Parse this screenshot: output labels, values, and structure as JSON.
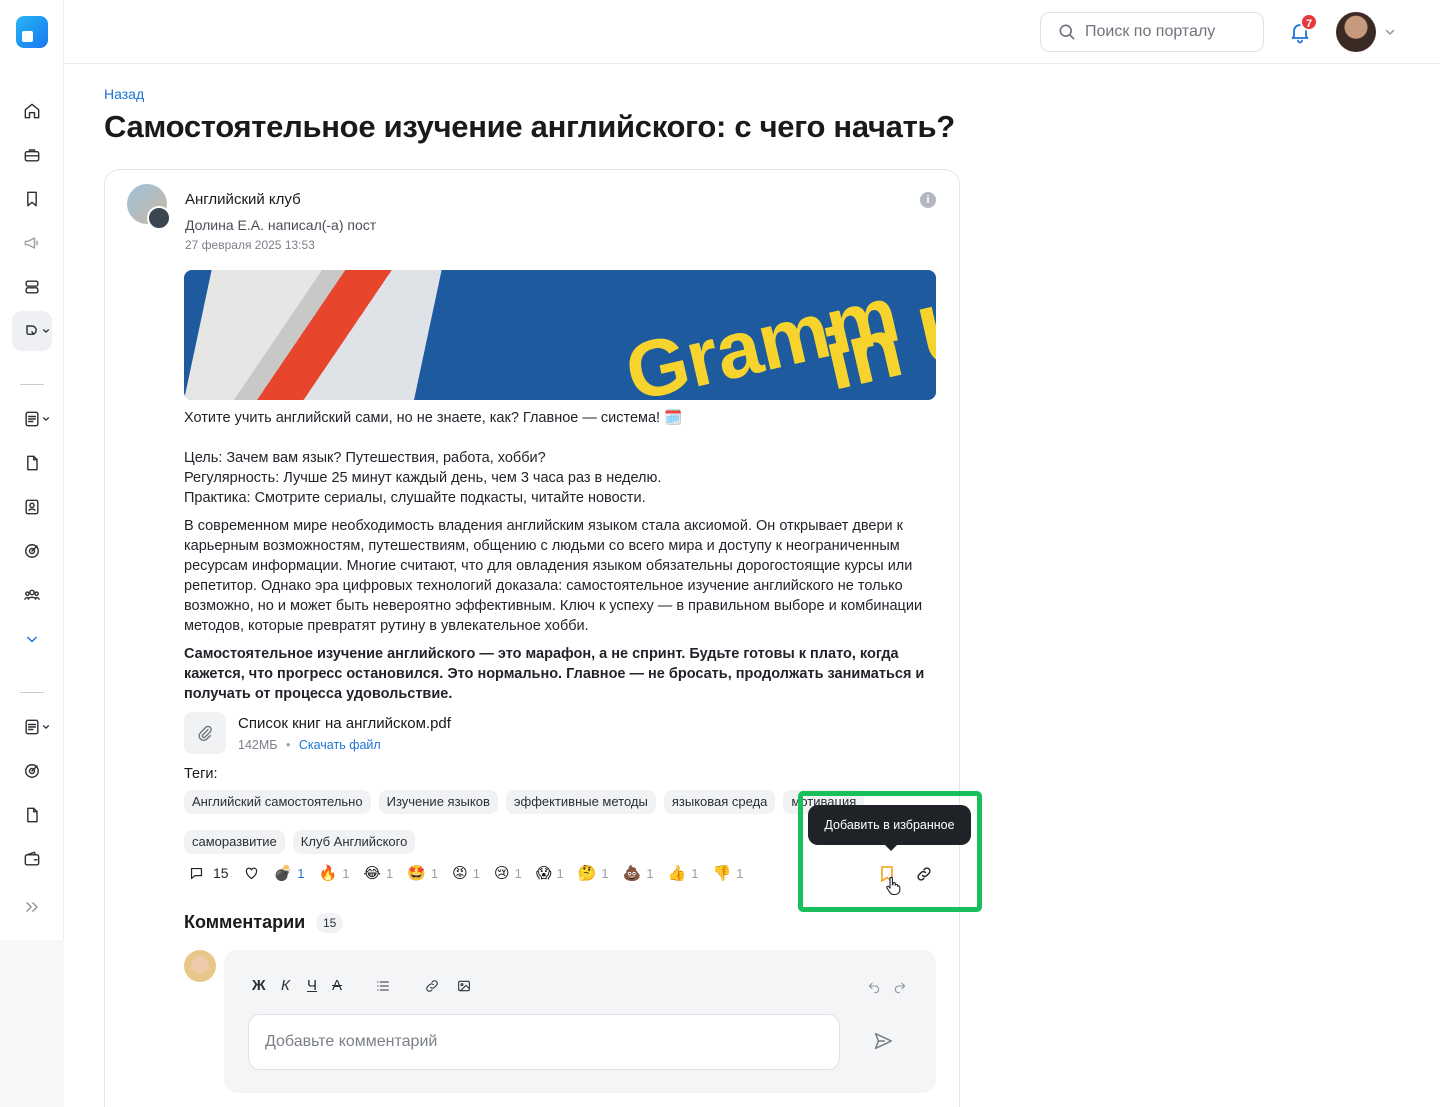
{
  "search": {
    "placeholder": "Поиск по порталу"
  },
  "notifications": {
    "count": "7"
  },
  "page": {
    "back_label": "Назад",
    "title": "Самостоятельное изучение английского: с чего начать?"
  },
  "post": {
    "club_name": "Английский клуб",
    "author_line": "Долина Е.А. написал(-а) пост",
    "date": "27 февраля 2025 13:53",
    "info_icon_label": "i",
    "cover_words": [
      "Gramm",
      "in Us"
    ],
    "intro": "Хотите учить английский сами, но не знаете, как? Главное — система! 🗓️",
    "goal": "Цель: Зачем вам язык? Путешествия, работа, хобби?",
    "regularity": "Регулярность: Лучше 25 минут каждый день, чем 3 часа раз в неделю.",
    "practice": "Практика: Смотрите сериалы, слушайте подкасты, читайте новости.",
    "paragraph": "В современном мире необходимость владения английским языком стала аксиомой. Он открывает двери к карьерным возможностям, путешествиям, общению с людьми со всего мира и доступу к неограниченным ресурсам информации. Многие считают, что для овладения языком обязательны дорогостоящие курсы или репетитор. Однако эра цифровых технологий доказала: самостоятельное изучение английского не только возможно, но и может быть невероятно эффективным. Ключ к успеху — в правильном выборе и комбинации методов, которые превратят рутину в увлекательное хобби.",
    "bold_paragraph": "Самостоятельное изучение английского — это марафон, а не спринт. Будьте готовы к плато, когда кажется, что прогресс остановился. Это нормально. Главное — не бросать, продолжать заниматься и получать от процесса удовольствие.",
    "file": {
      "name": "Список книг на английском.pdf",
      "size": "142МБ",
      "separator": "•",
      "download_label": "Скачать файл"
    },
    "tags_label": "Теги:",
    "tags": [
      "Английский самостоятельно",
      "Изучение языков",
      "эффективные методы",
      "языковая среда",
      "мотивация",
      "саморазвитие",
      "Клуб Английского"
    ],
    "comment_count": "15",
    "reactions": [
      {
        "emoji": "💣",
        "count": "1",
        "mine": true
      },
      {
        "emoji": "🔥",
        "count": "1",
        "mine": false
      },
      {
        "emoji": "😂",
        "count": "1",
        "mine": false
      },
      {
        "emoji": "🤩",
        "count": "1",
        "mine": false
      },
      {
        "emoji": "😡",
        "count": "1",
        "mine": false
      },
      {
        "emoji": "😢",
        "count": "1",
        "mine": false
      },
      {
        "emoji": "😱",
        "count": "1",
        "mine": false
      },
      {
        "emoji": "🤔",
        "count": "1",
        "mine": false
      },
      {
        "emoji": "💩",
        "count": "1",
        "mine": false
      },
      {
        "emoji": "👍",
        "count": "1",
        "mine": false
      },
      {
        "emoji": "👎",
        "count": "1",
        "mine": false
      }
    ],
    "favorite_tooltip": "Добавить в избранное"
  },
  "comments": {
    "heading": "Комментарии",
    "count": "15",
    "toolbar": {
      "bold": "Ж",
      "italic": "К",
      "underline": "Ч",
      "strike": "А"
    },
    "input_placeholder": "Добавьте комментарий"
  },
  "colors": {
    "accent": "#1d72d8",
    "highlight": "#19bf5a",
    "badge": "#e5393d",
    "favorite": "#f0a21b"
  }
}
